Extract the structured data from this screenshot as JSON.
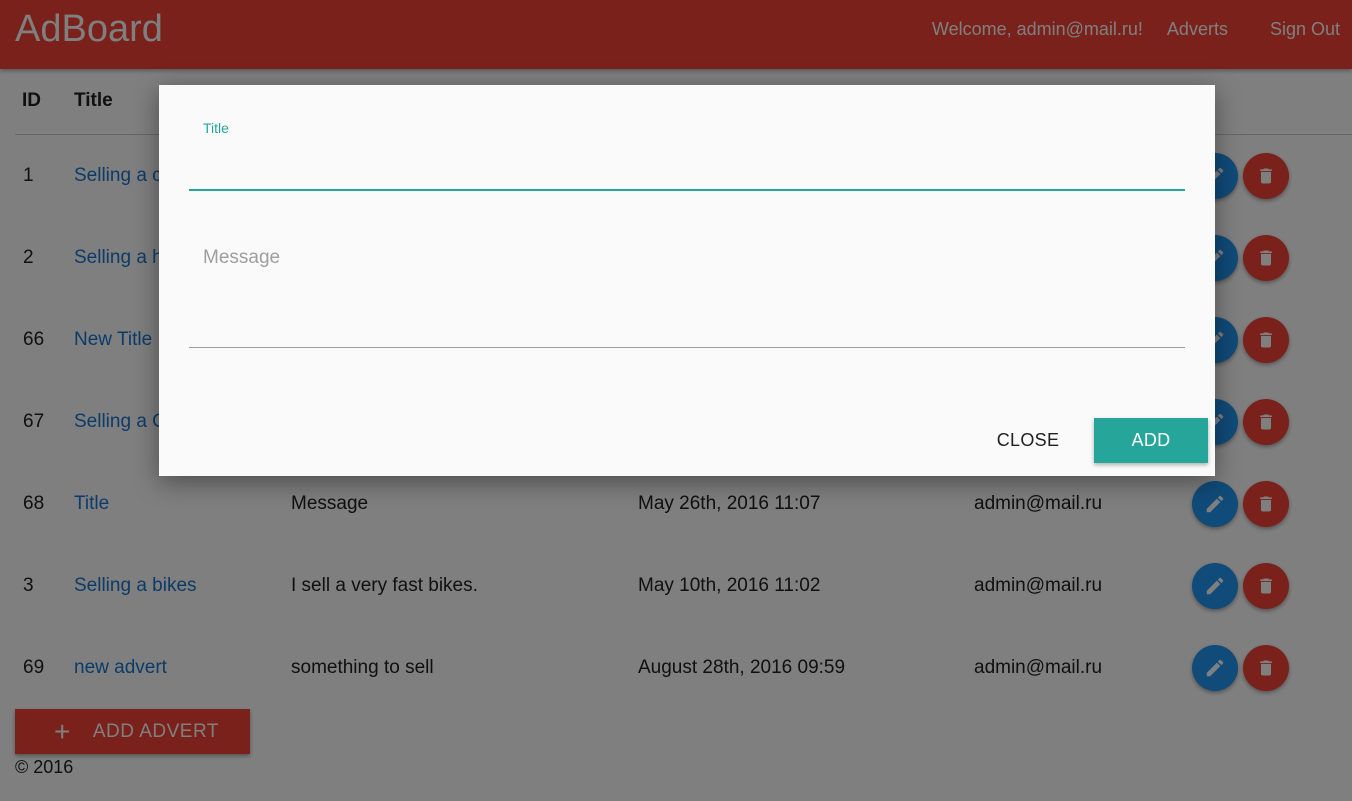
{
  "header": {
    "brand": "AdBoard",
    "welcome": "Welcome, admin@mail.ru!",
    "adverts_link": "Adverts",
    "signout_link": "Sign Out",
    "color": "#f44336"
  },
  "table": {
    "columns": [
      "ID",
      "Title"
    ],
    "rows": [
      {
        "id": "1",
        "title": "Selling a c",
        "message": "",
        "date": "",
        "author": ""
      },
      {
        "id": "2",
        "title": "Selling a h",
        "message": "",
        "date": "",
        "author": ""
      },
      {
        "id": "66",
        "title": "New Title",
        "message": "",
        "date": "",
        "author": ""
      },
      {
        "id": "67",
        "title": "Selling a C",
        "message": "",
        "date": "",
        "author": ""
      },
      {
        "id": "68",
        "title": "Title",
        "message": "Message",
        "date": "May 26th, 2016 11:07",
        "author": "admin@mail.ru"
      },
      {
        "id": "3",
        "title": "Selling a bikes",
        "message": "I sell a very fast bikes.",
        "date": "May 10th, 2016 11:02",
        "author": "admin@mail.ru"
      },
      {
        "id": "69",
        "title": "new advert",
        "message": "something to sell",
        "date": "August 28th, 2016 09:59",
        "author": "admin@mail.ru"
      }
    ],
    "edit_icon": "pencil-icon",
    "delete_icon": "trash-icon",
    "edit_color": "#2196f3",
    "delete_color": "#f44336"
  },
  "add_advert": {
    "plus": "+",
    "label": "ADD ADVERT"
  },
  "footer": {
    "text": "© 2016"
  },
  "dialog": {
    "title_label": "Title",
    "title_value": "",
    "message_placeholder": "Message",
    "message_value": "",
    "close_label": "CLOSE",
    "add_label": "ADD",
    "accent_color": "#26a69a"
  }
}
